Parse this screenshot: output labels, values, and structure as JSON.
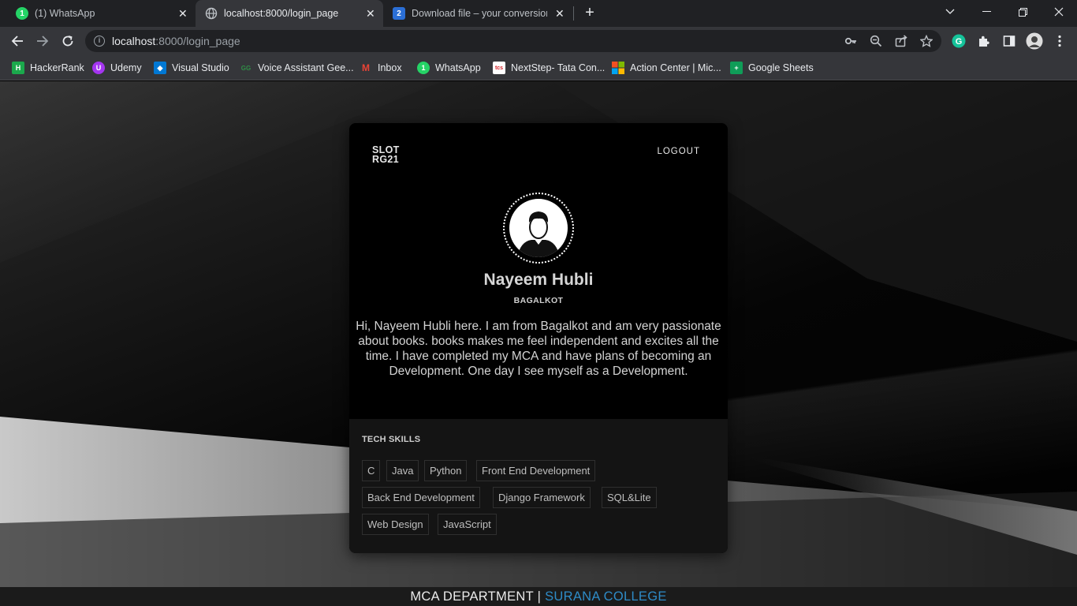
{
  "browser": {
    "tabs": [
      {
        "title": "(1) WhatsApp",
        "favicon": "whatsapp-icon",
        "favicon_text": "1",
        "active": false
      },
      {
        "title": "localhost:8000/login_page",
        "favicon": "globe-icon",
        "active": true
      },
      {
        "title": "Download file – your conversion",
        "favicon": "2conv-icon",
        "favicon_text": "2",
        "active": false
      }
    ],
    "url_host": "localhost",
    "url_path": ":8000/login_page",
    "bookmarks": [
      {
        "label": "HackerRank",
        "icon": "hackerrank-icon",
        "icon_text": "H",
        "color": "#1ba94c"
      },
      {
        "label": "Udemy",
        "icon": "udemy-icon",
        "icon_text": "U",
        "color": "#a435f0"
      },
      {
        "label": "Visual Studio",
        "icon": "visual-studio-icon",
        "icon_text": "◆",
        "color": "#0078d4"
      },
      {
        "label": "Voice Assistant Gee...",
        "icon": "geeksforgeeks-icon",
        "icon_text": "GG",
        "color": "#2f8d46"
      },
      {
        "label": "Inbox",
        "icon": "gmail-icon",
        "icon_text": "M",
        "color": "#ea4335"
      },
      {
        "label": "WhatsApp",
        "icon": "whatsapp-icon",
        "icon_text": "1",
        "color": "#25d366"
      },
      {
        "label": "NextStep- Tata Con...",
        "icon": "tcs-icon",
        "icon_text": "tcs",
        "color": "#d61f26"
      },
      {
        "label": "Action Center | Mic...",
        "icon": "microsoft-icon",
        "icon_text": "",
        "color": "#f25022"
      },
      {
        "label": "Google Sheets",
        "icon": "google-sheets-icon",
        "icon_text": "+",
        "color": "#0f9d58"
      }
    ]
  },
  "card": {
    "logo_line1": "SLOT",
    "logo_line2": "RG21",
    "logout": "LOGOUT",
    "name": "Nayeem Hubli",
    "location": "BAGALKOT",
    "bio": "Hi, Nayeem Hubli here. I am from Bagalkot and am very passionate about books. books makes me feel independent and excites all the time. I have completed my MCA and have plans of becoming an Development. One day I see myself as a Development."
  },
  "skills": {
    "title": "TECH SKILLS",
    "items": [
      "C",
      "Java",
      "Python",
      "Front End Development",
      "Back End Development",
      "Django Framework",
      "SQL&Lite",
      "Web Design",
      "JavaScript"
    ]
  },
  "footer": {
    "dept": "MCA DEPARTMENT |",
    "college": "SURANA COLLEGE"
  }
}
